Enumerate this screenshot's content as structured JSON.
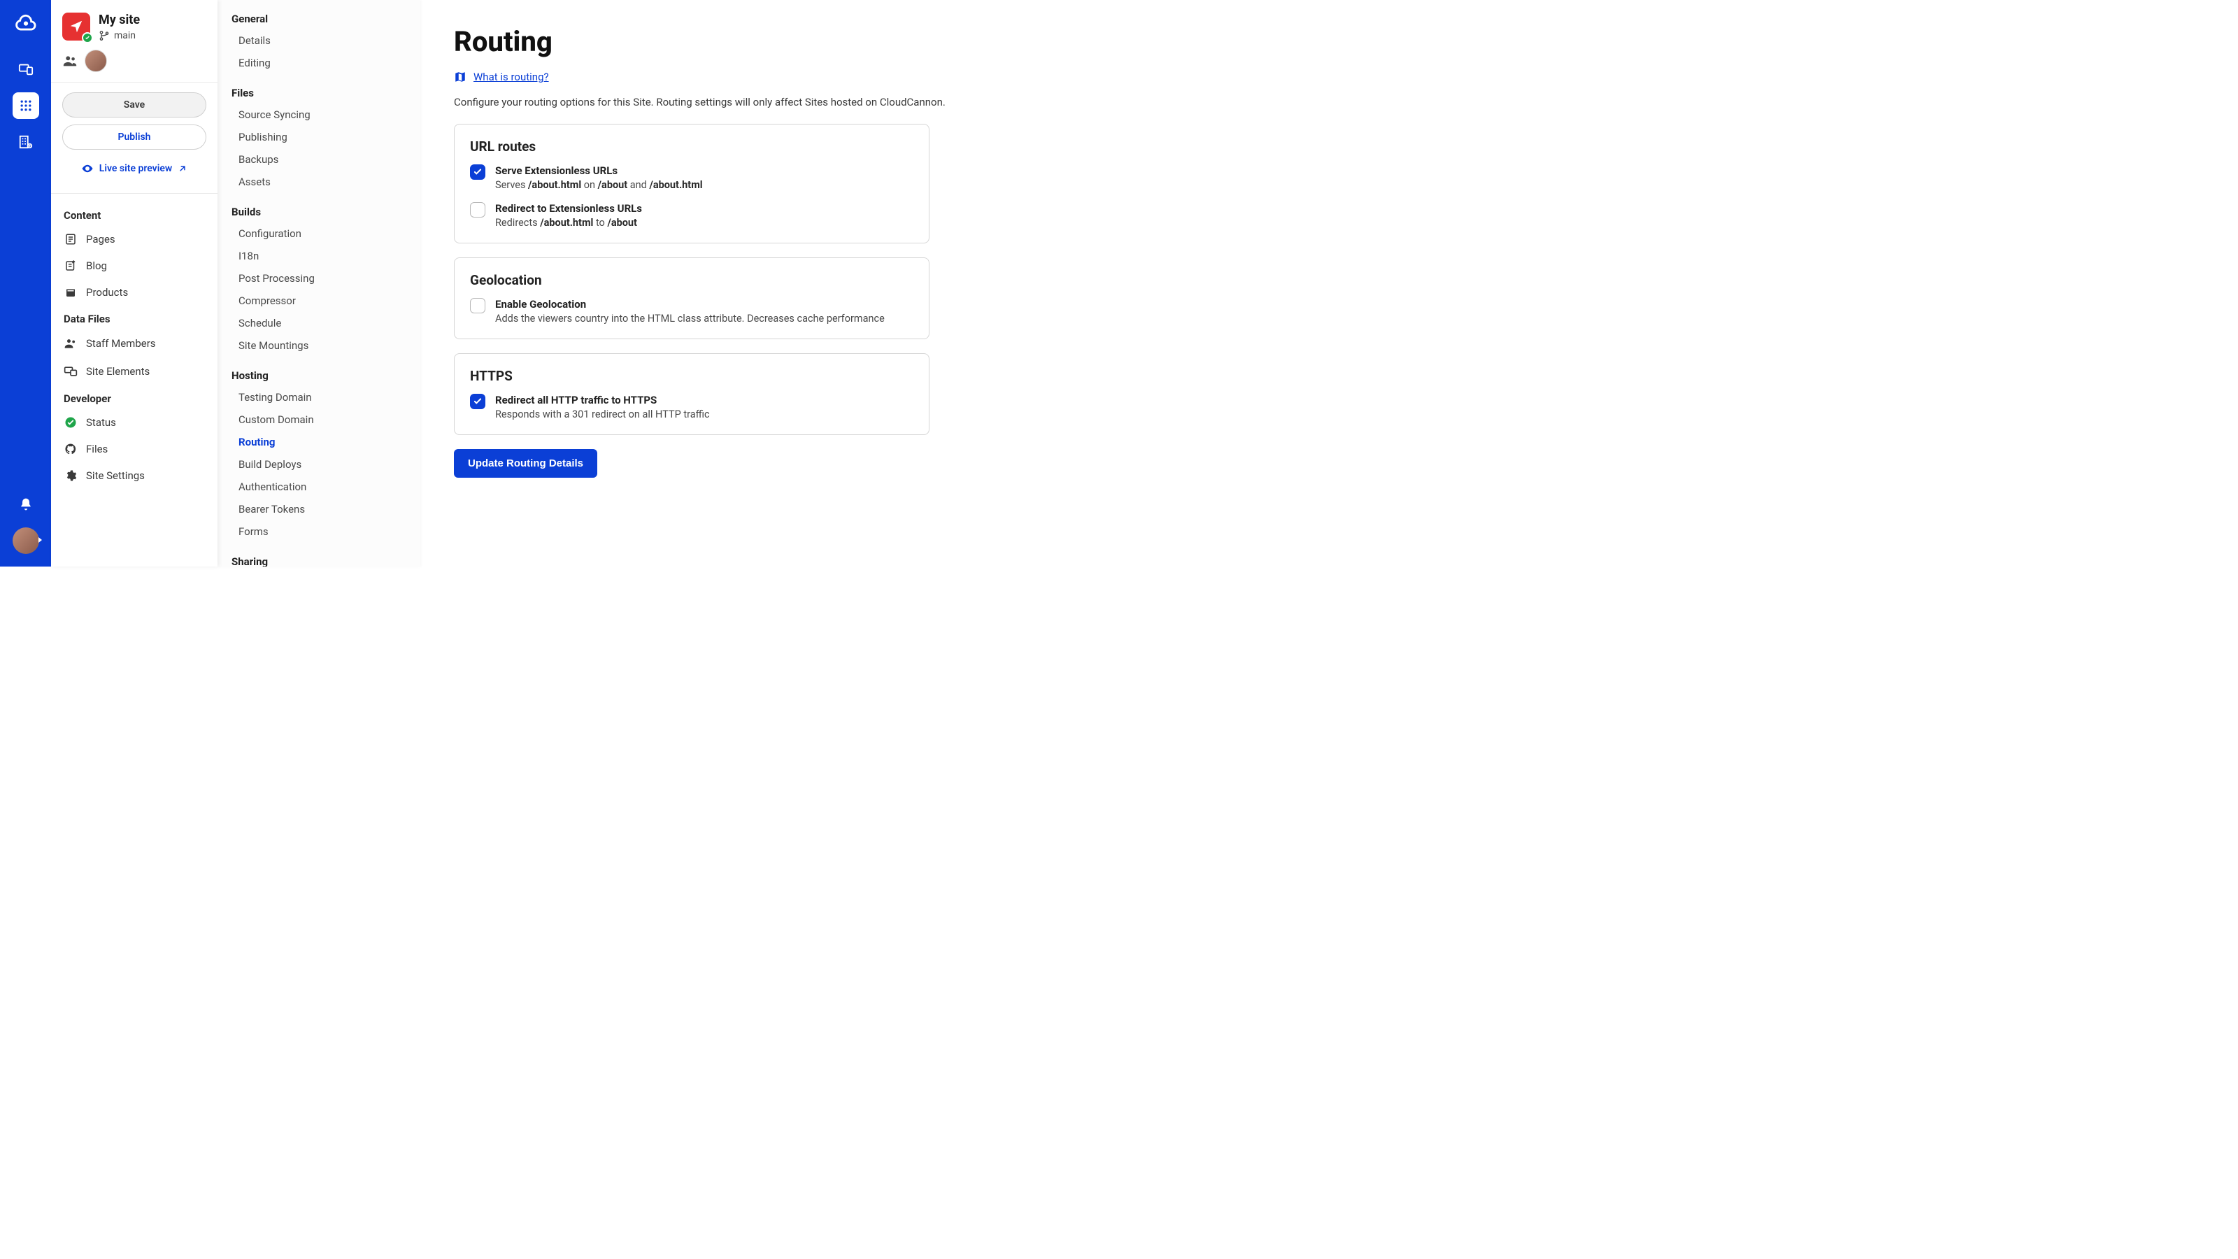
{
  "site": {
    "title": "My site",
    "branch": "main"
  },
  "actions": {
    "save": "Save",
    "publish": "Publish",
    "live_preview": "Live site preview"
  },
  "nav": {
    "content": {
      "title": "Content",
      "items": [
        "Pages",
        "Blog",
        "Products"
      ]
    },
    "data": {
      "title": "Data Files",
      "items": [
        "Staff Members",
        "Site Elements"
      ]
    },
    "developer": {
      "title": "Developer",
      "items": [
        "Status",
        "Files",
        "Site Settings"
      ]
    }
  },
  "settings_nav": {
    "general": {
      "title": "General",
      "items": [
        "Details",
        "Editing"
      ]
    },
    "files": {
      "title": "Files",
      "items": [
        "Source Syncing",
        "Publishing",
        "Backups",
        "Assets"
      ]
    },
    "builds": {
      "title": "Builds",
      "items": [
        "Configuration",
        "I18n",
        "Post Processing",
        "Compressor",
        "Schedule",
        "Site Mountings"
      ]
    },
    "hosting": {
      "title": "Hosting",
      "items": [
        "Testing Domain",
        "Custom Domain",
        "Routing",
        "Build Deploys",
        "Authentication",
        "Bearer Tokens",
        "Forms"
      ],
      "active": "Routing"
    },
    "sharing": {
      "title": "Sharing"
    }
  },
  "main": {
    "title": "Routing",
    "help_link": "What is routing?",
    "intro": "Configure your routing options for this Site. Routing settings will only affect Sites hosted on CloudCannon.",
    "url_routes": {
      "title": "URL routes",
      "serve": {
        "label": "Serve Extensionless URLs",
        "desc_prefix": "Serves ",
        "path1": "/about.html",
        "mid1": " on ",
        "path2": "/about",
        "mid2": " and ",
        "path3": "/about.html",
        "checked": true
      },
      "redirect": {
        "label": "Redirect to Extensionless URLs",
        "desc_prefix": "Redirects ",
        "path1": "/about.html",
        "mid1": " to ",
        "path2": "/about",
        "checked": false
      }
    },
    "geolocation": {
      "title": "Geolocation",
      "enable": {
        "label": "Enable Geolocation",
        "desc": "Adds the viewers country into the HTML class attribute. Decreases cache performance",
        "checked": false
      }
    },
    "https": {
      "title": "HTTPS",
      "redirect": {
        "label": "Redirect all HTTP traffic to HTTPS",
        "desc": "Responds with a 301 redirect on all HTTP traffic",
        "checked": true
      }
    },
    "update_button": "Update Routing Details"
  }
}
